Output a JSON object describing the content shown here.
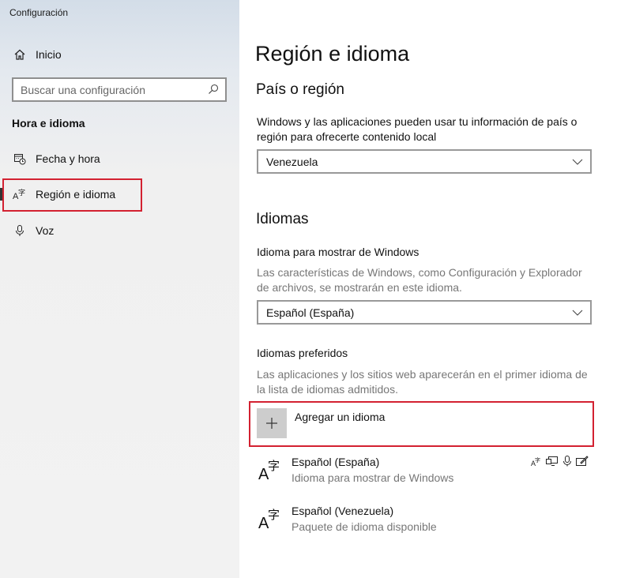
{
  "window": {
    "title": "Configuración"
  },
  "sidebar": {
    "home_label": "Inicio",
    "search_placeholder": "Buscar una configuración",
    "section_title": "Hora e idioma",
    "items": [
      {
        "label": "Fecha y hora",
        "icon": "calendar-clock-icon"
      },
      {
        "label": "Región e idioma",
        "icon": "language-icon",
        "selected": true
      },
      {
        "label": "Voz",
        "icon": "microphone-icon"
      }
    ]
  },
  "main": {
    "page_title": "Región e idioma",
    "region": {
      "heading": "País o región",
      "description": "Windows y las aplicaciones pueden usar tu información de país o región para ofrecerte contenido local",
      "selected": "Venezuela"
    },
    "languages": {
      "heading": "Idiomas",
      "display_label": "Idioma para mostrar de Windows",
      "display_description": "Las características de Windows, como Configuración y Explorador de archivos, se mostrarán en este idioma.",
      "display_selected": "Español (España)",
      "preferred_label": "Idiomas preferidos",
      "preferred_description": "Las aplicaciones y los sitios web aparecerán en el primer idioma de la lista de idiomas admitidos.",
      "add_label": "Agregar un idioma",
      "list": [
        {
          "name": "Español (España)",
          "sub": "Idioma para mostrar de Windows",
          "capabilities": [
            "language-pack-icon",
            "display-icon",
            "speech-icon",
            "handwriting-icon"
          ]
        },
        {
          "name": "Español (Venezuela)",
          "sub": "Paquete de idioma disponible",
          "capabilities": []
        }
      ]
    }
  },
  "colors": {
    "highlight": "#d32131",
    "accent_bar": "#333333"
  }
}
